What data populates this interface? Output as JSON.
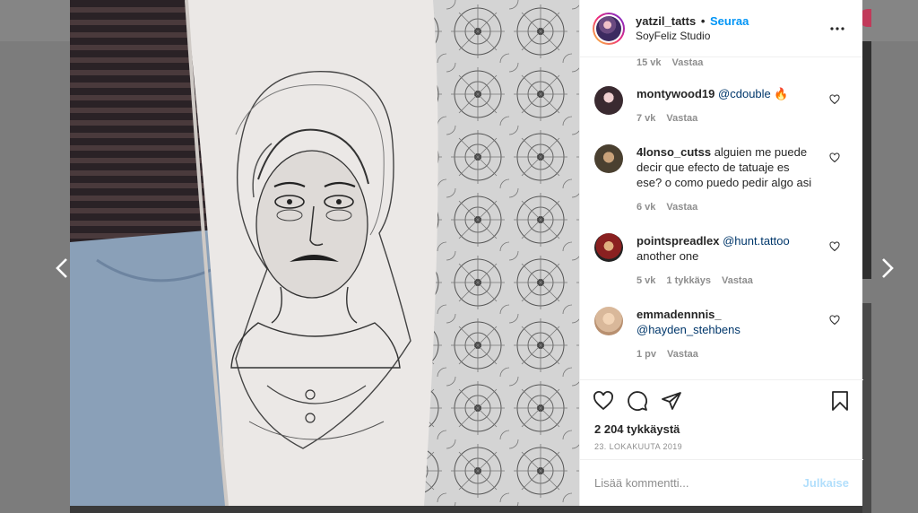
{
  "post": {
    "username": "yatzil_tatts",
    "separator": "•",
    "follow_label": "Seuraa",
    "location": "SoyFeliz Studio",
    "more_icon": "more-horizontal-icon"
  },
  "comments_top_meta": {
    "time": "15 vk",
    "reply": "Vastaa"
  },
  "comments": [
    {
      "username": "montywood19",
      "mention": "@cdouble",
      "text": " 🔥",
      "time": "7 vk",
      "likes": "",
      "reply": "Vastaa",
      "avatar_color": "#3a2a30"
    },
    {
      "username": "4lonso_cutss",
      "mention": "",
      "text": " alguien me puede decir que efecto de tatuaje es ese? o como puedo pedir algo asi",
      "time": "6 vk",
      "likes": "",
      "reply": "Vastaa",
      "avatar_color": "#4a4030"
    },
    {
      "username": "pointspreadlex",
      "mention": "@hunt.tattoo",
      "text": " another one",
      "time": "5 vk",
      "likes": "1 tykkäys",
      "reply": "Vastaa",
      "avatar_color": "#8a2020"
    },
    {
      "username": "emmadennnis_",
      "mention": "@hayden_stehbens",
      "text": "",
      "time": "1 pv",
      "likes": "",
      "reply": "Vastaa",
      "avatar_color": "#d9b89a"
    }
  ],
  "actions": {
    "like_icon": "heart-icon",
    "comment_icon": "comment-icon",
    "share_icon": "share-icon",
    "save_icon": "bookmark-icon"
  },
  "likes_count": "2 204 tykkäystä",
  "post_date": "23. LOKAKUUTA 2019",
  "add_comment": {
    "placeholder": "Lisää kommentti...",
    "publish_label": "Julkaise"
  },
  "colors": {
    "link": "#0095f6",
    "mention": "#00376b",
    "muted": "#8e8e8e",
    "publish_disabled": "#b2dffc"
  }
}
